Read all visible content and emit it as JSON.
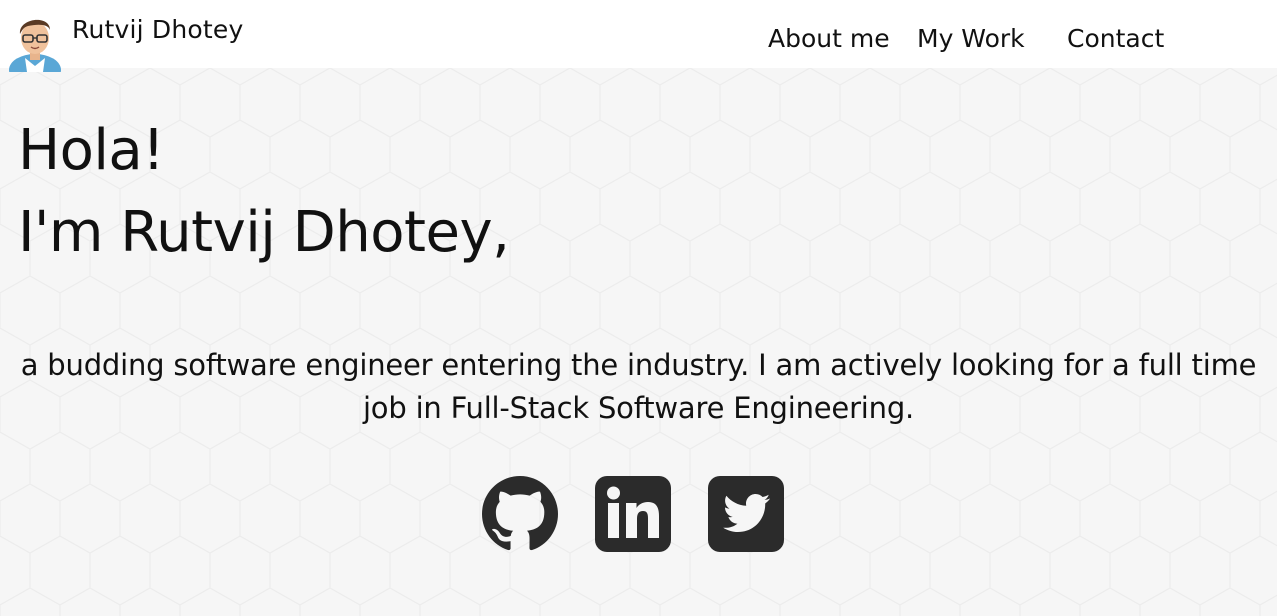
{
  "header": {
    "site_name": "Rutvij Dhotey",
    "nav": [
      {
        "label": "About me"
      },
      {
        "label": "My Work"
      },
      {
        "label": "Contact"
      }
    ]
  },
  "hero": {
    "greeting": "Hola!",
    "intro": "I'm Rutvij Dhotey,",
    "tagline": "a budding software engineer entering the industry. I am actively looking for a full time job in Full-Stack Software Engineering."
  },
  "socials": [
    {
      "icon": "github-icon"
    },
    {
      "icon": "linkedin-icon"
    },
    {
      "icon": "twitter-icon"
    }
  ],
  "colors": {
    "header_bg": "#ffffff",
    "page_bg": "#f6f6f6",
    "text": "#111111",
    "icon": "#2b2b2b"
  }
}
